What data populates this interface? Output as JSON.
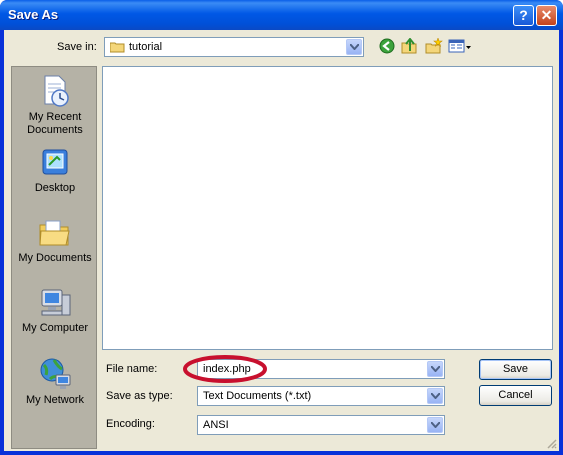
{
  "window": {
    "title": "Save As",
    "help_glyph": "?",
    "close_glyph": "✕"
  },
  "save_in": {
    "label": "Save in:",
    "value": "tutorial"
  },
  "toolbar": {
    "icons": [
      "back-icon",
      "up-folder-icon",
      "new-folder-icon",
      "views-menu-icon"
    ]
  },
  "places": [
    {
      "label": "My Recent\nDocuments",
      "icon": "recent-documents-icon"
    },
    {
      "label": "Desktop",
      "icon": "desktop-icon"
    },
    {
      "label": "My Documents",
      "icon": "my-documents-icon"
    },
    {
      "label": "My Computer",
      "icon": "my-computer-icon"
    },
    {
      "label": "My Network",
      "icon": "my-network-icon"
    }
  ],
  "file_name": {
    "label": "File name:",
    "value": "index.php"
  },
  "save_as_type": {
    "label": "Save as type:",
    "value": "Text Documents (*.txt)"
  },
  "encoding": {
    "label": "Encoding:",
    "value": "ANSI"
  },
  "buttons": {
    "save": "Save",
    "cancel": "Cancel"
  },
  "colors": {
    "titlebar": "#0058e6",
    "dialog_bg": "#ece9d8",
    "places_bg": "#b5b2a6",
    "highlight_circle": "#c8102e"
  }
}
